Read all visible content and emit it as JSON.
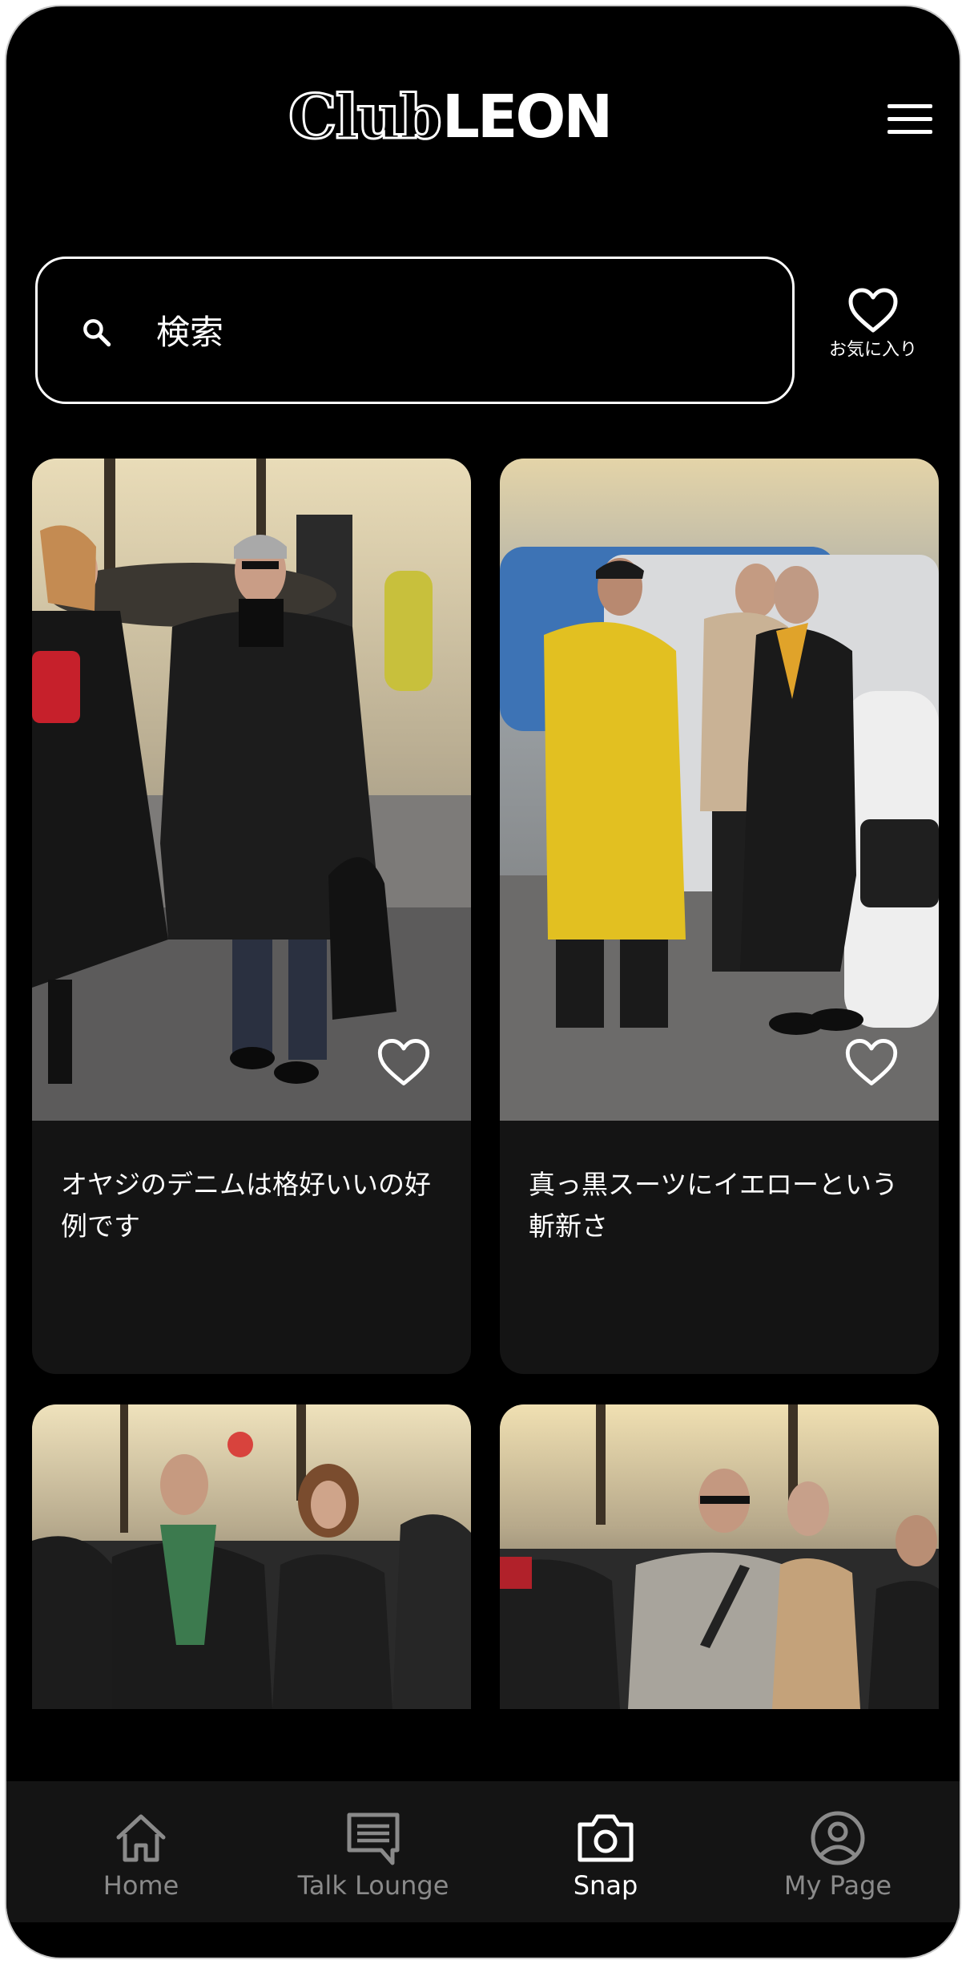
{
  "header": {
    "logo_club": "Club",
    "logo_leon": "LEON"
  },
  "search": {
    "placeholder": "検索"
  },
  "favorites": {
    "label": "お気に入り"
  },
  "cards": [
    {
      "caption": "オヤジのデニムは格好いいの好例です",
      "favorited": false
    },
    {
      "caption": "真っ黒スーツにイエローという斬新さ",
      "favorited": false
    }
  ],
  "bottom_nav": {
    "items": [
      {
        "label": "Home",
        "icon": "home-icon",
        "active": false
      },
      {
        "label": "Talk Lounge",
        "icon": "chat-icon",
        "active": false
      },
      {
        "label": "Snap",
        "icon": "camera-icon",
        "active": true
      },
      {
        "label": "My Page",
        "icon": "user-icon",
        "active": false
      }
    ]
  },
  "colors": {
    "background": "#000000",
    "card": "#141414",
    "nav_inactive": "#8a8a8a",
    "nav_active": "#ffffff"
  }
}
